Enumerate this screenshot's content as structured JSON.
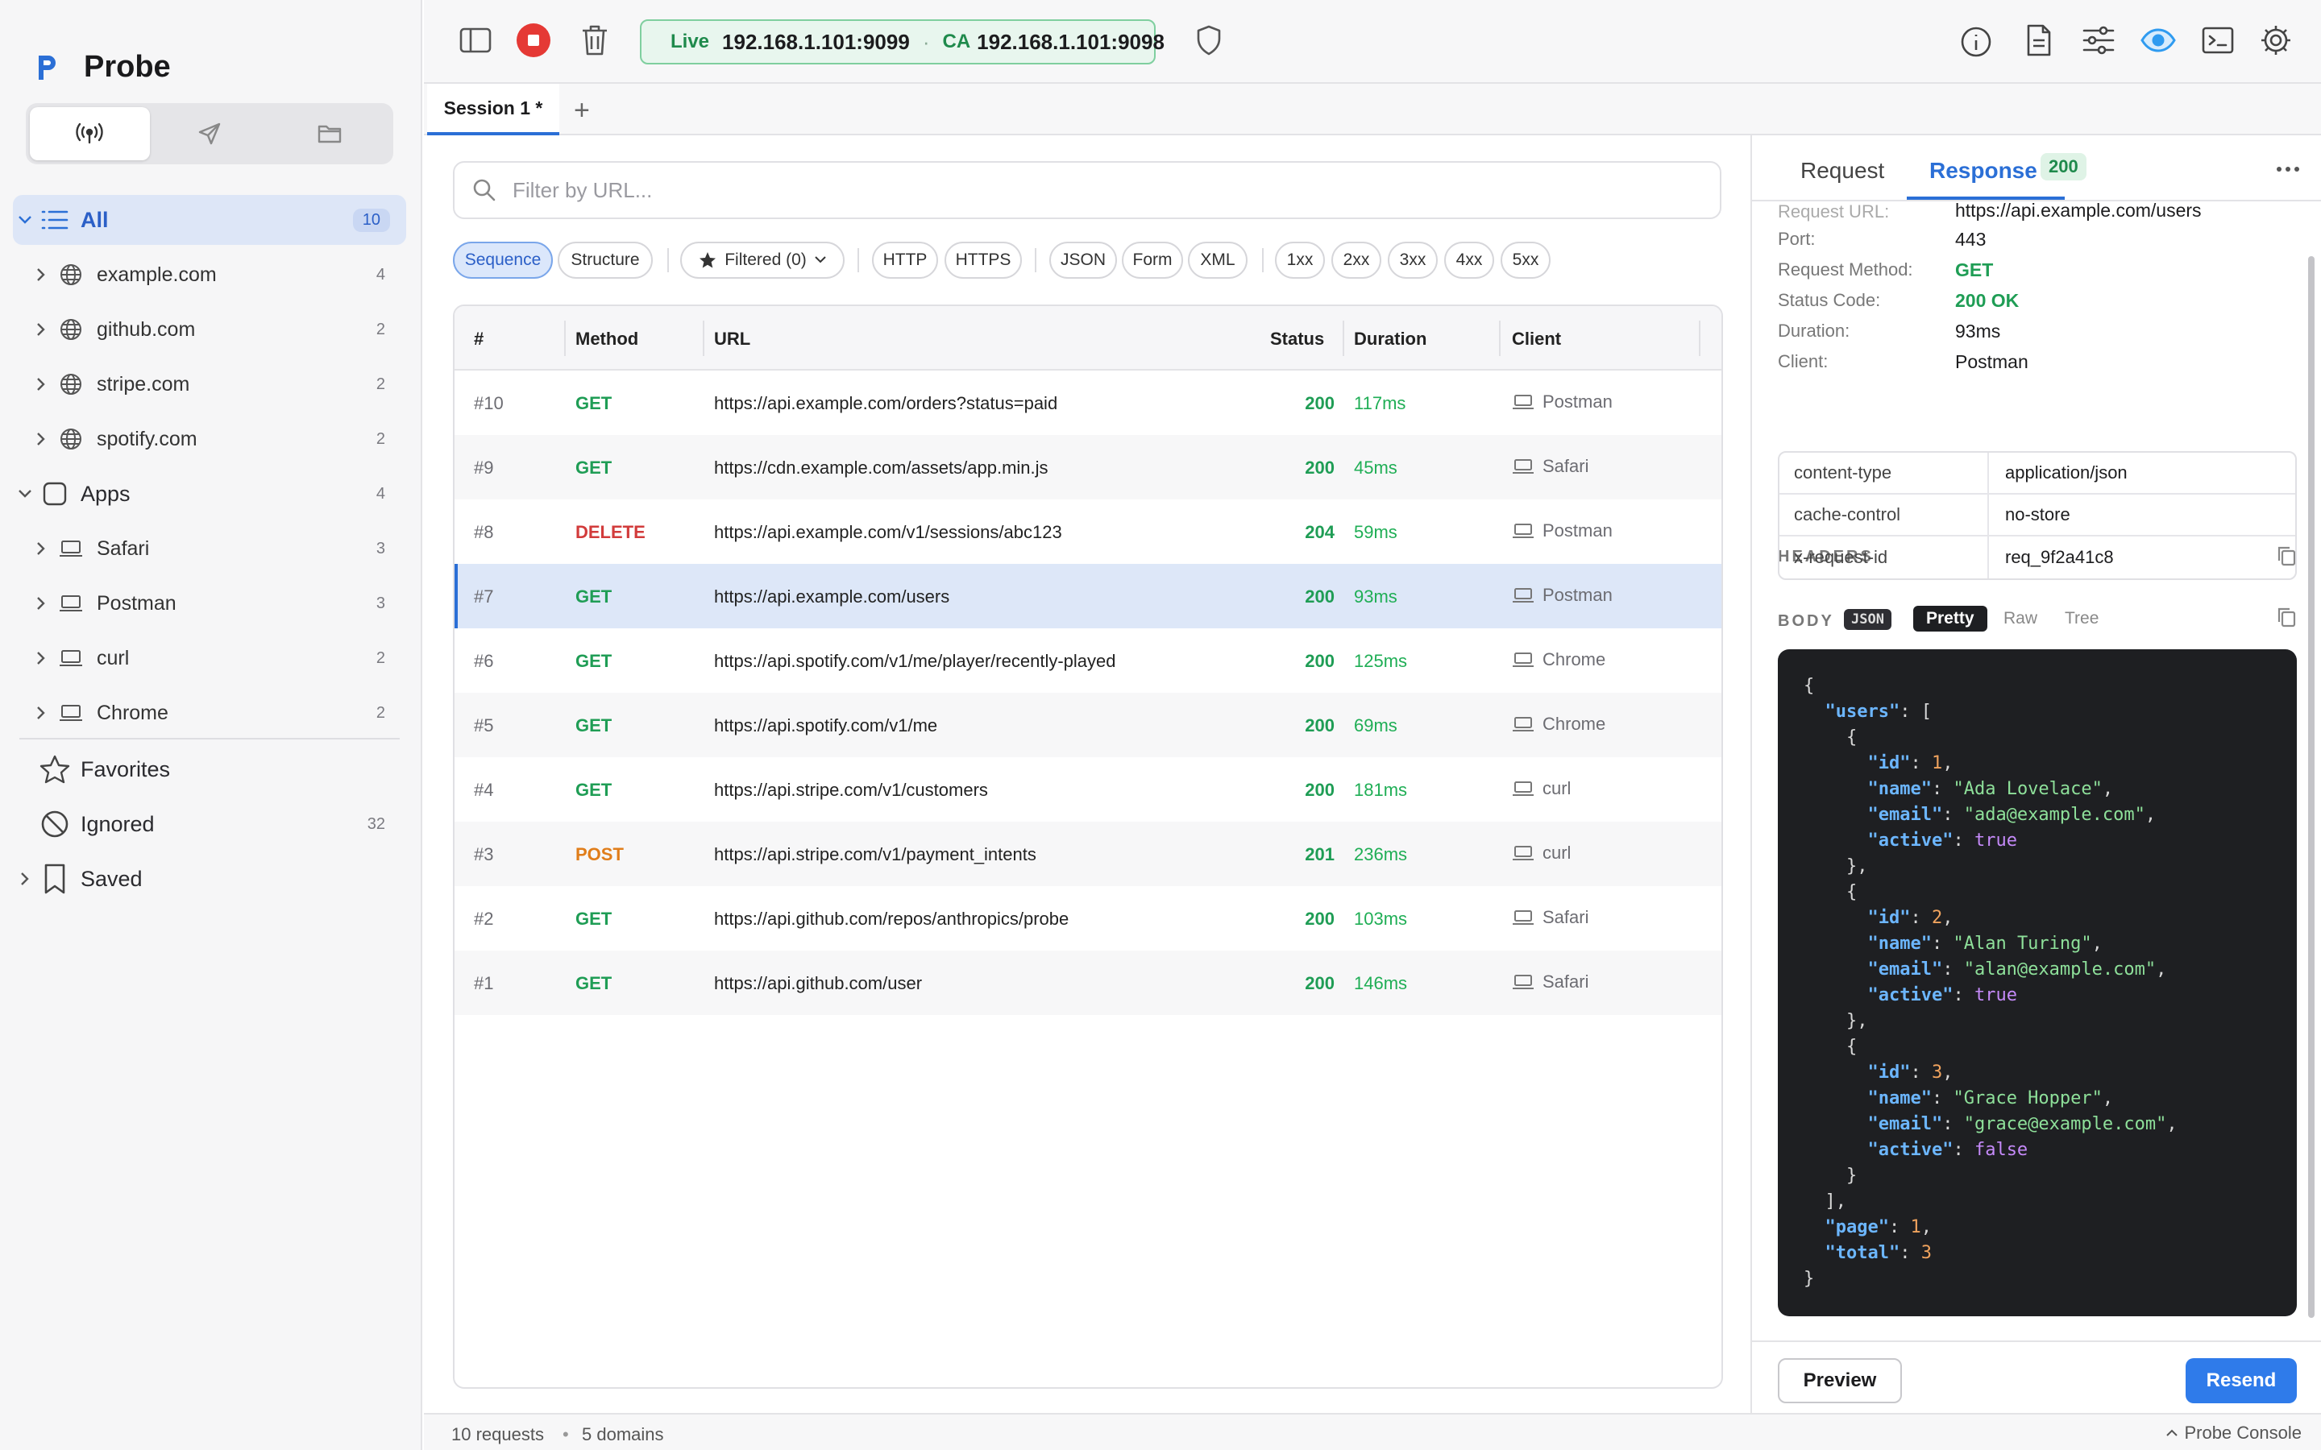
{
  "app": {
    "name": "Probe"
  },
  "sidebar": {
    "all": {
      "label": "All",
      "count": "10"
    },
    "domains": [
      {
        "label": "example.com",
        "count": "4"
      },
      {
        "label": "github.com",
        "count": "2"
      },
      {
        "label": "stripe.com",
        "count": "2"
      },
      {
        "label": "spotify.com",
        "count": "2"
      }
    ],
    "apps": {
      "label": "Apps",
      "count": "4"
    },
    "app_items": [
      {
        "label": "Safari",
        "count": "3"
      },
      {
        "label": "Postman",
        "count": "3"
      },
      {
        "label": "curl",
        "count": "2"
      },
      {
        "label": "Chrome",
        "count": "2"
      }
    ],
    "favorites": {
      "label": "Favorites"
    },
    "ignored": {
      "label": "Ignored",
      "count": "32"
    },
    "saved": {
      "label": "Saved"
    }
  },
  "toolbar": {
    "live_label": "Live",
    "proxy_address": "192.168.1.101:9099",
    "separator": "·",
    "ca_label": "CA",
    "ca_address": "192.168.1.101:9098"
  },
  "tabs": {
    "session": "Session 1 *",
    "add": "+"
  },
  "filters": {
    "search_placeholder": "Filter by URL...",
    "view_modes": [
      "Sequence",
      "Structure"
    ],
    "filtered": "Filtered (0)",
    "protocols": [
      "HTTP",
      "HTTPS"
    ],
    "content_types": [
      "JSON",
      "Form",
      "XML"
    ],
    "status_classes": [
      "1xx",
      "2xx",
      "3xx",
      "4xx",
      "5xx"
    ]
  },
  "table": {
    "headers": {
      "num": "#",
      "method": "Method",
      "url": "URL",
      "status": "Status",
      "duration": "Duration",
      "client": "Client"
    },
    "rows": [
      {
        "num": "#10",
        "method": "GET",
        "url": "https://api.example.com/orders?status=paid",
        "status": "200",
        "duration": "117ms",
        "client": "Postman"
      },
      {
        "num": "#9",
        "method": "GET",
        "url": "https://cdn.example.com/assets/app.min.js",
        "status": "200",
        "duration": "45ms",
        "client": "Safari"
      },
      {
        "num": "#8",
        "method": "DELETE",
        "url": "https://api.example.com/v1/sessions/abc123",
        "status": "204",
        "duration": "59ms",
        "client": "Postman"
      },
      {
        "num": "#7",
        "method": "GET",
        "url": "https://api.example.com/users",
        "status": "200",
        "duration": "93ms",
        "client": "Postman"
      },
      {
        "num": "#6",
        "method": "GET",
        "url": "https://api.spotify.com/v1/me/player/recently-played",
        "status": "200",
        "duration": "125ms",
        "client": "Chrome"
      },
      {
        "num": "#5",
        "method": "GET",
        "url": "https://api.spotify.com/v1/me",
        "status": "200",
        "duration": "69ms",
        "client": "Chrome"
      },
      {
        "num": "#4",
        "method": "GET",
        "url": "https://api.stripe.com/v1/customers",
        "status": "200",
        "duration": "181ms",
        "client": "curl"
      },
      {
        "num": "#3",
        "method": "POST",
        "url": "https://api.stripe.com/v1/payment_intents",
        "status": "201",
        "duration": "236ms",
        "client": "curl"
      },
      {
        "num": "#2",
        "method": "GET",
        "url": "https://api.github.com/repos/anthropics/probe",
        "status": "200",
        "duration": "103ms",
        "client": "Safari"
      },
      {
        "num": "#1",
        "method": "GET",
        "url": "https://api.github.com/user",
        "status": "200",
        "duration": "146ms",
        "client": "Safari"
      }
    ]
  },
  "detail": {
    "tabs": {
      "request": "Request",
      "response": "Response",
      "status_badge": "200"
    },
    "general": [
      {
        "key": "Request URL:",
        "value": "https://api.example.com/users"
      },
      {
        "key": "Port:",
        "value": "443"
      },
      {
        "key": "Request Method:",
        "value": "GET"
      },
      {
        "key": "Status Code:",
        "value": "200 OK"
      },
      {
        "key": "Duration:",
        "value": "93ms"
      },
      {
        "key": "Client:",
        "value": "Postman"
      }
    ],
    "headers_title": "HEADERS",
    "headers": [
      {
        "key": "content-type",
        "value": "application/json"
      },
      {
        "key": "cache-control",
        "value": "no-store"
      },
      {
        "key": "x-request-id",
        "value": "req_9f2a41c8"
      }
    ],
    "body_title": "BODY",
    "body_format": "JSON",
    "body_views": [
      "Pretty",
      "Raw",
      "Tree"
    ],
    "body": {
      "users": [
        {
          "id": 1,
          "name": "Ada Lovelace",
          "email": "ada@example.com",
          "active": true
        },
        {
          "id": 2,
          "name": "Alan Turing",
          "email": "alan@example.com",
          "active": true
        },
        {
          "id": 3,
          "name": "Grace Hopper",
          "email": "grace@example.com",
          "active": false
        }
      ],
      "page": 1,
      "total": 3
    },
    "preview_label": "Preview",
    "resend_label": "Resend"
  },
  "statusbar": {
    "requests": "10 requests",
    "dot": "•",
    "domains": "5 domains",
    "console": "Probe Console"
  },
  "colors": {
    "accent": "#2b6fd6",
    "success": "#1f9d55",
    "danger": "#d23b3b",
    "warning": "#e07d1a",
    "live": "#1f8a4c"
  }
}
